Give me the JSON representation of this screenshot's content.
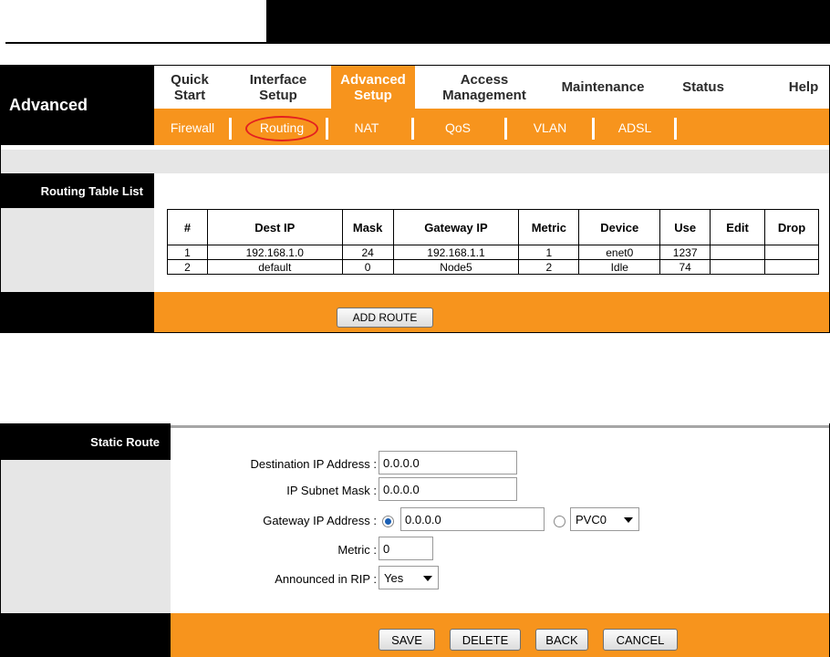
{
  "nav": {
    "section_label": "Advanced",
    "items": [
      {
        "line1": "Quick",
        "line2": "Start"
      },
      {
        "line1": "Interface",
        "line2": "Setup"
      },
      {
        "line1": "Advanced",
        "line2": "Setup"
      },
      {
        "line1": "Access",
        "line2": "Management"
      },
      {
        "line1": "Maintenance",
        "line2": ""
      },
      {
        "line1": "Status",
        "line2": ""
      },
      {
        "line1": "Help",
        "line2": ""
      }
    ],
    "sub_items": [
      "Firewall",
      "Routing",
      "NAT",
      "QoS",
      "VLAN",
      "ADSL"
    ],
    "active_item": "Advanced Setup",
    "active_sub_item": "Routing"
  },
  "routing_list": {
    "label": "Routing Table List",
    "columns": [
      "#",
      "Dest IP",
      "Mask",
      "Gateway IP",
      "Metric",
      "Device",
      "Use",
      "Edit",
      "Drop"
    ],
    "rows": [
      [
        "1",
        "192.168.1.0",
        "24",
        "192.168.1.1",
        "1",
        "enet0",
        "1237",
        "",
        ""
      ],
      [
        "2",
        "default",
        "0",
        "Node5",
        "2",
        "Idle",
        "74",
        "",
        ""
      ]
    ],
    "add_route_label": "ADD ROUTE"
  },
  "static_route": {
    "label": "Static Route",
    "dest_ip_label": "Destination IP Address :",
    "dest_ip_value": "0.0.0.0",
    "subnet_label": "IP Subnet Mask :",
    "subnet_value": "0.0.0.0",
    "gateway_label": "Gateway IP Address :",
    "gateway_value": "0.0.0.0",
    "gateway_pvc_value": "PVC0",
    "metric_label": "Metric :",
    "metric_value": "0",
    "rip_label": "Announced in RIP :",
    "rip_value": "Yes",
    "buttons": {
      "save": "SAVE",
      "delete": "DELETE",
      "back": "BACK",
      "cancel": "CANCEL"
    }
  },
  "colors": {
    "accent_orange": "#f7941d",
    "panel_gray": "#e6e6e6",
    "highlight_red": "#e32020"
  }
}
